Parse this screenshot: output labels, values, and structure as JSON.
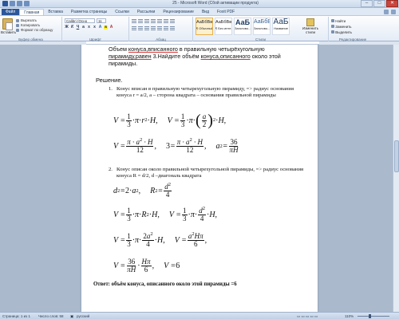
{
  "window": {
    "title": "25 - Microsoft Word (Сбой активации продукта)",
    "buttons": [
      "–",
      "□",
      "✕"
    ]
  },
  "tabs": [
    "Файл",
    "Главная",
    "Вставка",
    "Разметка страницы",
    "Ссылки",
    "Рассылки",
    "Рецензирование",
    "Вид",
    "Foxit PDF"
  ],
  "active_tab": "Главная",
  "ribbon": {
    "clipboard": {
      "paste": "Вставить",
      "cut": "Вырезать",
      "copy": "Копировать",
      "format_painter": "Формат по образцу",
      "label": "Буфер обмена"
    },
    "font": {
      "name": "Calibri (Осно",
      "size": "11",
      "label": "Шрифт"
    },
    "paragraph": {
      "label": "Абзац"
    },
    "styles": {
      "items": [
        {
          "sample": "АаБбВвГг",
          "name": "¶ Обычный"
        },
        {
          "sample": "АаБбВвГг",
          "name": "¶ Без инте..."
        },
        {
          "sample": "АаБ",
          "name": "Заголово..."
        },
        {
          "sample": "АаБбВв",
          "name": "Заголово..."
        },
        {
          "sample": "АаБ",
          "name": "Название"
        }
      ],
      "change": "Изменить стили",
      "label": "Стили"
    },
    "editing": {
      "find": "Найти",
      "replace": "Заменить",
      "select": "Выделить",
      "label": "Редактирование"
    }
  },
  "document": {
    "task": {
      "p1": "Объем ",
      "u1": "конуса,вписанного",
      "p2": " в правильную четырёхугольную ",
      "u2": "пирамиду,равен",
      "p3": " 3.Найдите объём ",
      "u3": "конуса,описанного",
      "p4": " около этой пирамиды."
    },
    "solution_label": "Решение.",
    "item1_num": "1.",
    "item1_text": "Конус вписан в правильную четырехугольную пирамиду, => радиус основания конуса r = a/2, a – сторона квадрата – основания правильной пирамиды",
    "item2_num": "2.",
    "item2_text": "Конус описан около правильной четырехугольной пирамиды, => радиус основания конуса  R = d/2, d –диагональ квадрата",
    "answer": "Ответ: объём конуса, описанного около этой пирамиды =6"
  },
  "status": {
    "page": "Страница: 1 из 1",
    "words": "Число слов: 58",
    "language": "русский",
    "zoom": "110%"
  }
}
